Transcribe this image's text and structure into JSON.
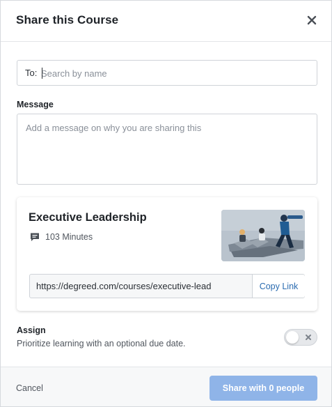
{
  "dialog": {
    "title": "Share this Course",
    "close_icon": "close-icon"
  },
  "recipients": {
    "label": "To:",
    "placeholder": "Search by name",
    "value": ""
  },
  "message": {
    "label": "Message",
    "placeholder": "Add a message on why you are sharing this",
    "value": ""
  },
  "course": {
    "title": "Executive Leadership",
    "duration_icon": "chat-bubble-icon",
    "duration": "103 Minutes",
    "thumbnail": "course-illustration",
    "url": "https://degreed.com/courses/executive-lead",
    "copy_label": "Copy Link"
  },
  "assign": {
    "title": "Assign",
    "description": "Prioritize learning with an optional due date.",
    "enabled": false
  },
  "footer": {
    "cancel_label": "Cancel",
    "share_label": "Share with 0 people"
  },
  "colors": {
    "primary_disabled": "#8fb4e8",
    "link": "#2a6bb0",
    "text": "#1f2328",
    "muted": "#50565e"
  }
}
